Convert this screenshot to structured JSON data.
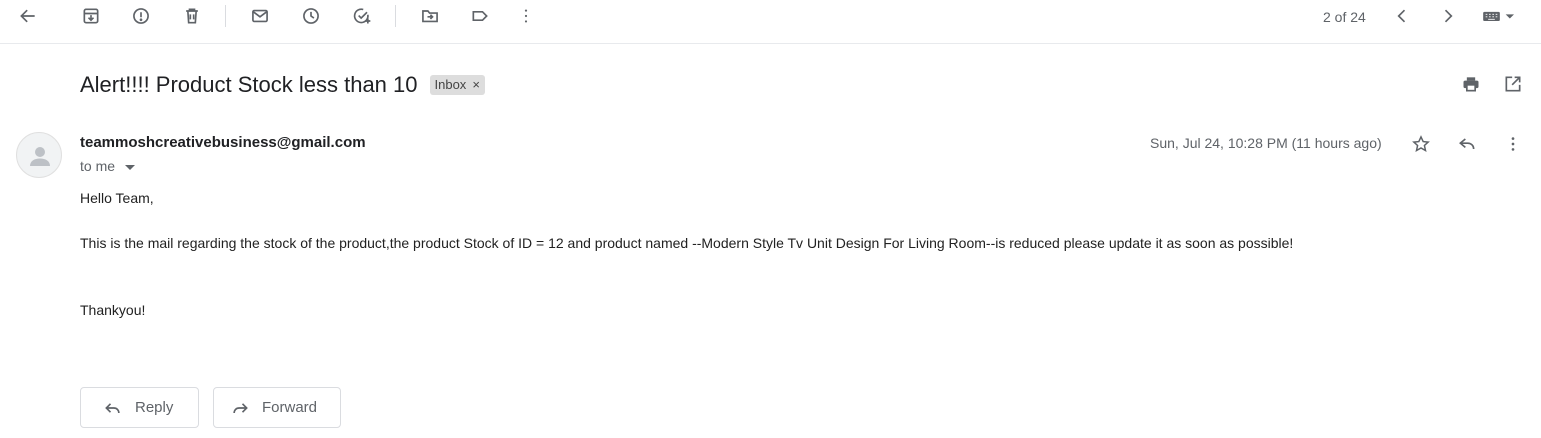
{
  "toolbar": {
    "pager_text": "2 of 24",
    "icons": [
      "back-arrow-icon",
      "archive-icon",
      "report-spam-icon",
      "delete-icon",
      "mark-unread-icon",
      "snooze-icon",
      "add-to-tasks-icon",
      "move-to-icon",
      "label-icon",
      "more-vert-icon",
      "newer-chevron-icon",
      "older-chevron-icon",
      "keyboard-icon"
    ]
  },
  "email": {
    "subject": "Alert!!!! Product Stock less than 10",
    "label": "Inbox",
    "label_remove": "×",
    "sender": "teammoshcreativebusiness@gmail.com",
    "recipient": "to me",
    "date": "Sun, Jul 24, 10:28 PM (11 hours ago)",
    "greeting": "Hello Team,",
    "body": "This is the mail regarding the stock of the product,the product Stock of ID = 12 and product named --Modern Style Tv Unit Design For Living Room--is reduced please update it as soon as possible!",
    "signoff": "Thankyou!"
  },
  "actions": {
    "reply_label": "Reply",
    "forward_label": "Forward"
  },
  "colors": {
    "icon": "#5f6368",
    "divider": "#e8eaed",
    "chip_bg": "#dddddd"
  }
}
